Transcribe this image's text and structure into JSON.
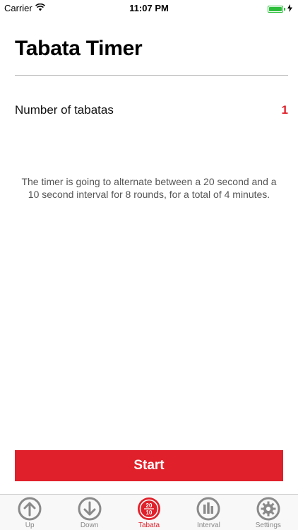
{
  "status_bar": {
    "carrier": "Carrier",
    "time": "11:07 PM",
    "battery_color": "#2dbe3c"
  },
  "header": {
    "title": "Tabata Timer"
  },
  "settings": {
    "number_of_tabatas_label": "Number of tabatas",
    "number_of_tabatas_value": "1"
  },
  "description": "The timer is going to alternate between a 20 second and a 10 second interval for 8 rounds, for a total of 4 minutes.",
  "actions": {
    "start_label": "Start"
  },
  "tabs": [
    {
      "label": "Up",
      "icon": "arrow-up-icon",
      "active": false
    },
    {
      "label": "Down",
      "icon": "arrow-down-icon",
      "active": false
    },
    {
      "label": "Tabata",
      "icon": "tabata-icon",
      "active": true,
      "icon_text_top": "20",
      "icon_text_bottom": "10"
    },
    {
      "label": "Interval",
      "icon": "interval-bars-icon",
      "active": false
    },
    {
      "label": "Settings",
      "icon": "gear-icon",
      "active": false
    }
  ],
  "colors": {
    "accent": "#e0202a",
    "inactive_tab": "#8a8a8a"
  }
}
